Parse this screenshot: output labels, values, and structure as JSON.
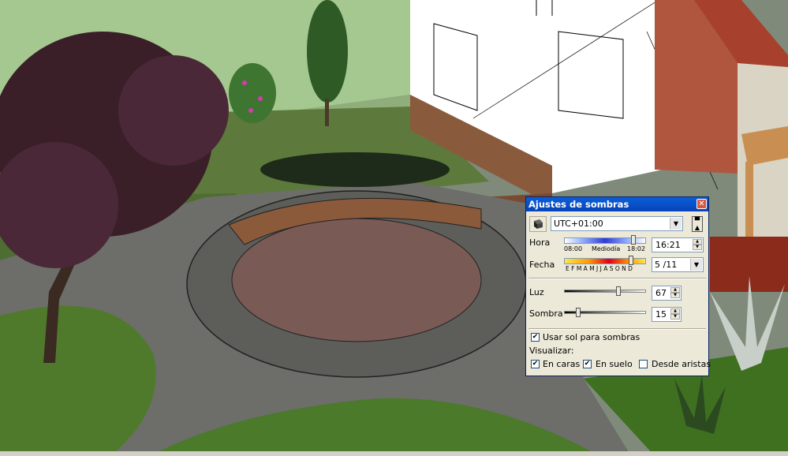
{
  "dialog": {
    "title": "Ajustes de sombras",
    "timezone": "UTC+01:00",
    "hora_label": "Hora",
    "time_start": "08:00",
    "time_mid": "Mediodía",
    "time_end": "18:02",
    "time_value": "16:21",
    "fecha_label": "Fecha",
    "months": "E F M A M J J A S O N D",
    "date_value": "5 /11",
    "luz_label": "Luz",
    "luz_value": "67",
    "sombra_label": "Sombra",
    "sombra_value": "15",
    "use_sun_label": "Usar sol para sombras",
    "visualizar_label": "Visualizar:",
    "en_caras_label": "En caras",
    "en_suelo_label": "En suelo",
    "desde_aristas_label": "Desde aristas",
    "use_sun_checked": true,
    "en_caras_checked": true,
    "en_suelo_checked": true,
    "desde_aristas_checked": false,
    "time_fraction": 0.87,
    "date_fraction": 0.84,
    "luz_fraction": 0.67,
    "sombra_fraction": 0.15
  },
  "icons": {
    "shadow_toggle": "shadow-icon",
    "collapse": "collapse-icon",
    "close": "close-icon"
  }
}
